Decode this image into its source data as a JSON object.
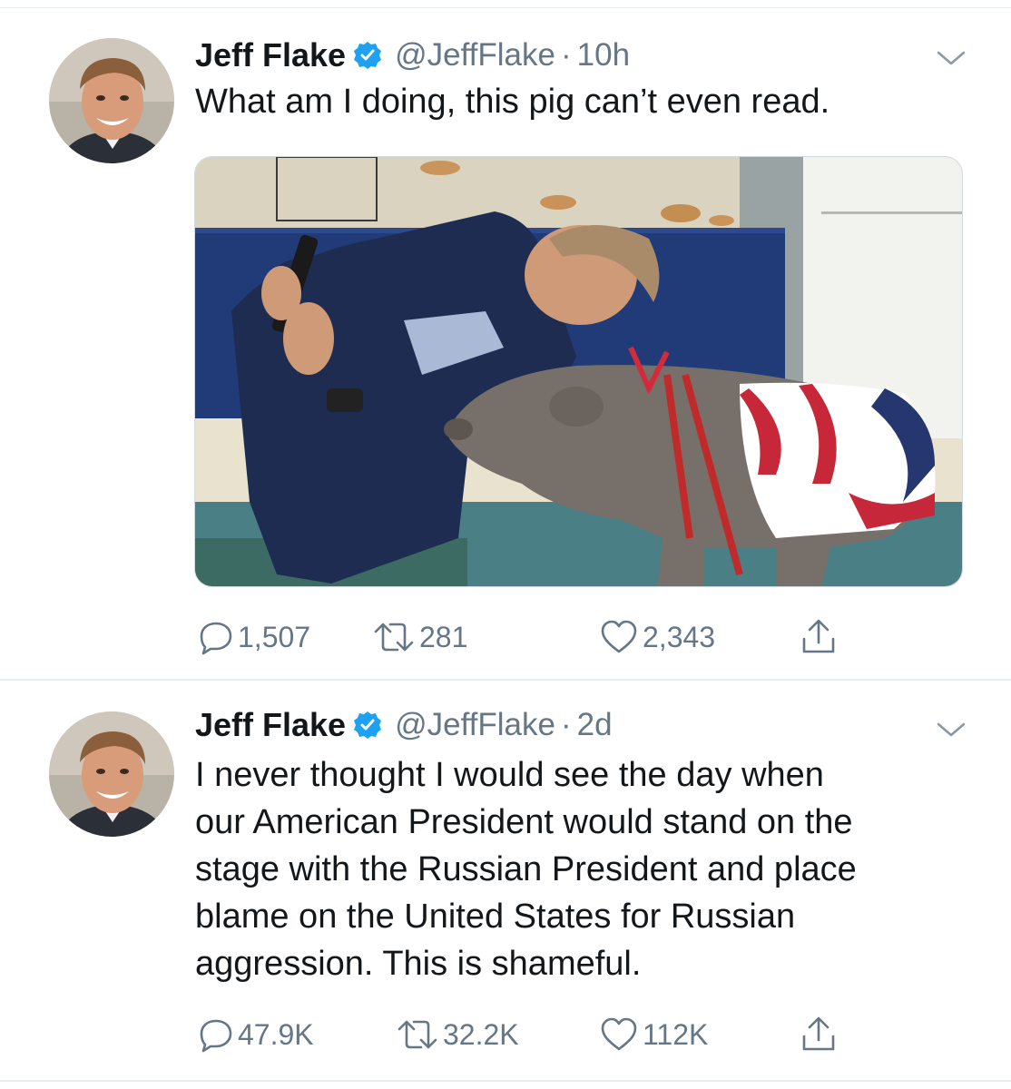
{
  "tweets": [
    {
      "display_name": "Jeff Flake",
      "handle": "@JeffFlake",
      "separator": "·",
      "time": "10h",
      "text": "What am I doing, this pig can’t even read.",
      "media": {
        "description_icon": "photo-man-selfie-with-pig-icon"
      },
      "replies": "1,507",
      "retweets": "281",
      "likes": "2,343"
    },
    {
      "display_name": "Jeff Flake",
      "handle": "@JeffFlake",
      "separator": "·",
      "time": "2d",
      "text_lines": [
        "I never thought I would see the day when",
        "our American President would stand on the",
        "stage with the Russian President and place",
        "blame on the United States for Russian",
        "aggression. This is shameful."
      ],
      "replies": "47.9K",
      "retweets": "32.2K",
      "likes": "112K"
    }
  ],
  "colors": {
    "verified": "#1da1f2",
    "secondary_text": "#657786",
    "divider": "#e6ecf0"
  }
}
